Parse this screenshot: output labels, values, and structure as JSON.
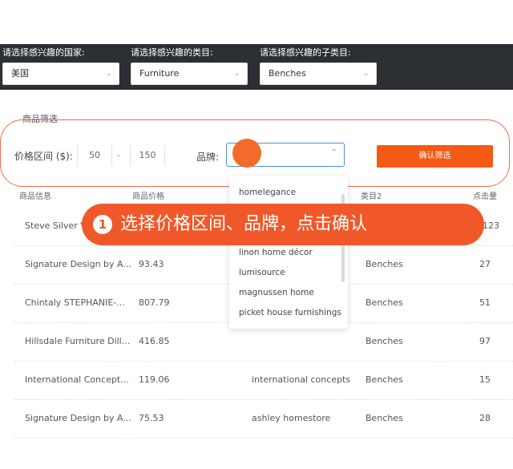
{
  "filters": {
    "country": {
      "label": "请选择感兴趣的国家:",
      "value": "美国"
    },
    "category": {
      "label": "请选择感兴趣的类目:",
      "value": "Furniture"
    },
    "subcategory": {
      "label": "请选择感兴趣的子类目:",
      "value": "Benches"
    }
  },
  "screening": {
    "title": "商品筛选",
    "price_label": "价格区间 ($):",
    "price_min": "50",
    "price_separator": "-",
    "price_max": "150",
    "brand_label": "品牌:",
    "confirm_label": "确认筛选"
  },
  "table": {
    "headers": [
      "商品信息",
      "商品价格",
      "类目2",
      "点击量"
    ],
    "rows": [
      {
        "name": "Steve Silver Vi...",
        "price": "",
        "brand": "",
        "category": "",
        "clicks": "123"
      },
      {
        "name": "Signature Design by A...",
        "price": "93.43",
        "brand": "",
        "category": "Benches",
        "clicks": "27"
      },
      {
        "name": "Chintaly STEPHANIE-...",
        "price": "807.79",
        "brand": "",
        "category": "Benches",
        "clicks": "51"
      },
      {
        "name": "Hillsdale Furniture Dill...",
        "price": "416.85",
        "brand": "",
        "category": "Benches",
        "clicks": "97"
      },
      {
        "name": "International Concept...",
        "price": "119.06",
        "brand": "international concepts",
        "category": "Benches",
        "clicks": "15"
      },
      {
        "name": "Signature Design by A...",
        "price": "75.53",
        "brand": "ashley homestore",
        "category": "Benches",
        "clicks": "28"
      }
    ]
  },
  "brand_dropdown": {
    "options": [
      "homelegance",
      "linon home décor",
      "lumisource",
      "magnussen home",
      "picket house furnishings"
    ]
  },
  "tutorial_banner": {
    "step": "1",
    "text": "选择价格区间、品牌，点击确认"
  },
  "colors": {
    "accent": "#f45a14",
    "banner": "#f0582a",
    "topbar": "#2c2f34",
    "focus": "#4a90e2"
  }
}
